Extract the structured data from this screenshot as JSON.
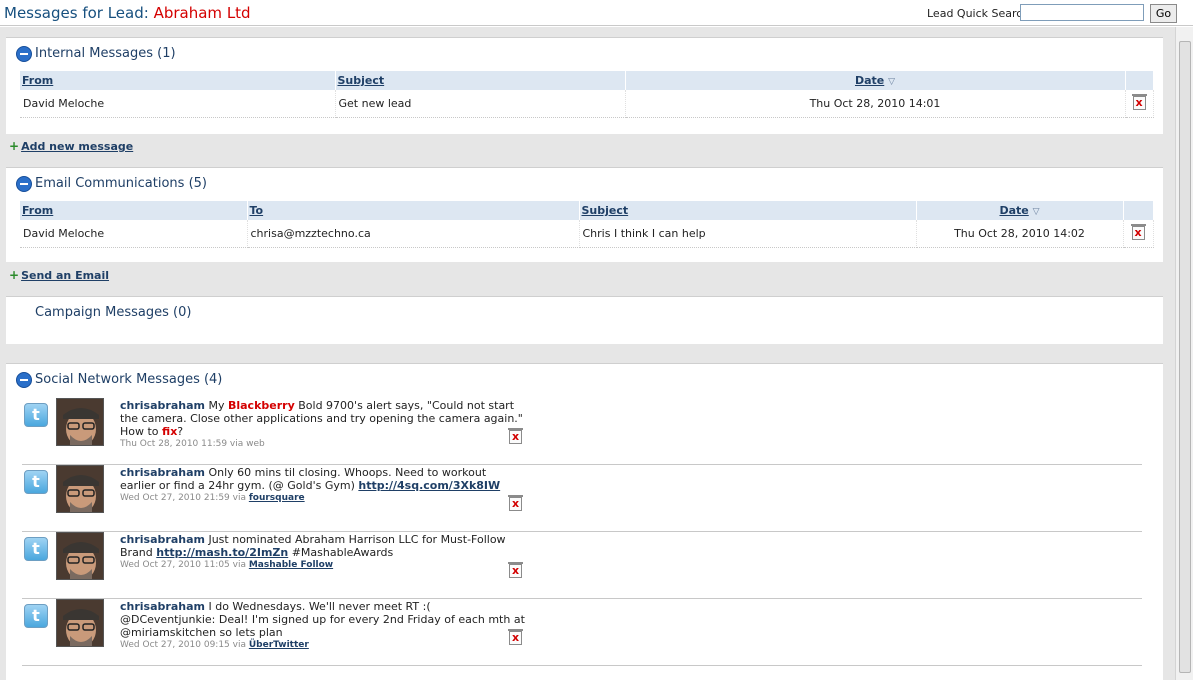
{
  "header": {
    "title_prefix": "Messages for Lead:",
    "lead_name": "Abraham Ltd",
    "quick_search_label": "Lead Quick Search",
    "quick_search_value": "",
    "go_label": "Go"
  },
  "internal": {
    "title": "Internal Messages (1)",
    "columns": {
      "from": "From",
      "subject": "Subject",
      "date": "Date"
    },
    "rows": [
      {
        "from": "David Meloche",
        "subject": "Get new lead",
        "date": "Thu Oct 28, 2010 14:01"
      }
    ],
    "add_label": "Add new message"
  },
  "email": {
    "title": "Email Communications (5)",
    "columns": {
      "from": "From",
      "to": "To",
      "subject": "Subject",
      "date": "Date"
    },
    "rows": [
      {
        "from": "David Meloche",
        "to": "chrisa@mzztechno.ca",
        "subject": "Chris I think I can help",
        "date": "Thu Oct 28, 2010 14:02"
      }
    ],
    "add_label": "Send an Email"
  },
  "campaign": {
    "title": "Campaign Messages (0)"
  },
  "social": {
    "title": "Social Network Messages (4)",
    "items": [
      {
        "user": "chrisabraham",
        "t1": " My ",
        "hl1": "Blackberry",
        "t2": " Bold 9700's alert says, \"Could not start the camera. Close other applications and try opening the camera again.\" How to ",
        "hl2": "fix",
        "t3": "?",
        "meta_date": "Thu Oct 28, 2010 11:59 via ",
        "meta_via": "web"
      },
      {
        "user": "chrisabraham",
        "t1": " Only 60 mins til closing. Whoops. Need to workout earlier or find a 24hr gym. (@ Gold's Gym) ",
        "link": "http://4sq.com/3Xk8IW",
        "meta_date": "Wed Oct 27, 2010 21:59 via ",
        "meta_via": "foursquare"
      },
      {
        "user": "chrisabraham",
        "t1": " Just nominated Abraham Harrison LLC for Must-Follow Brand ",
        "link": "http://mash.to/2ImZn",
        "t2": " #MashableAwards",
        "meta_date": "Wed Oct 27, 2010 11:05 via ",
        "meta_via": "Mashable Follow"
      },
      {
        "user": "chrisabraham",
        "t1": " I do Wednesdays. We'll never meet RT :( @DCeventjunkie: Deal! I'm signed up for every 2nd Friday of each mth at @miriamskitchen so lets plan",
        "meta_date": "Wed Oct 27, 2010 09:15 via ",
        "meta_via": "ÜberTwitter"
      }
    ]
  },
  "icons": {
    "collapse": "collapse-minus-icon",
    "delete": "delete-icon",
    "twitter": "twitter-icon",
    "add": "plus-icon"
  },
  "colors": {
    "title_blue": "#17507f",
    "lead_red": "#d40000",
    "header_row_bg": "#dde7f2",
    "link_blue": "#1f3f66"
  }
}
